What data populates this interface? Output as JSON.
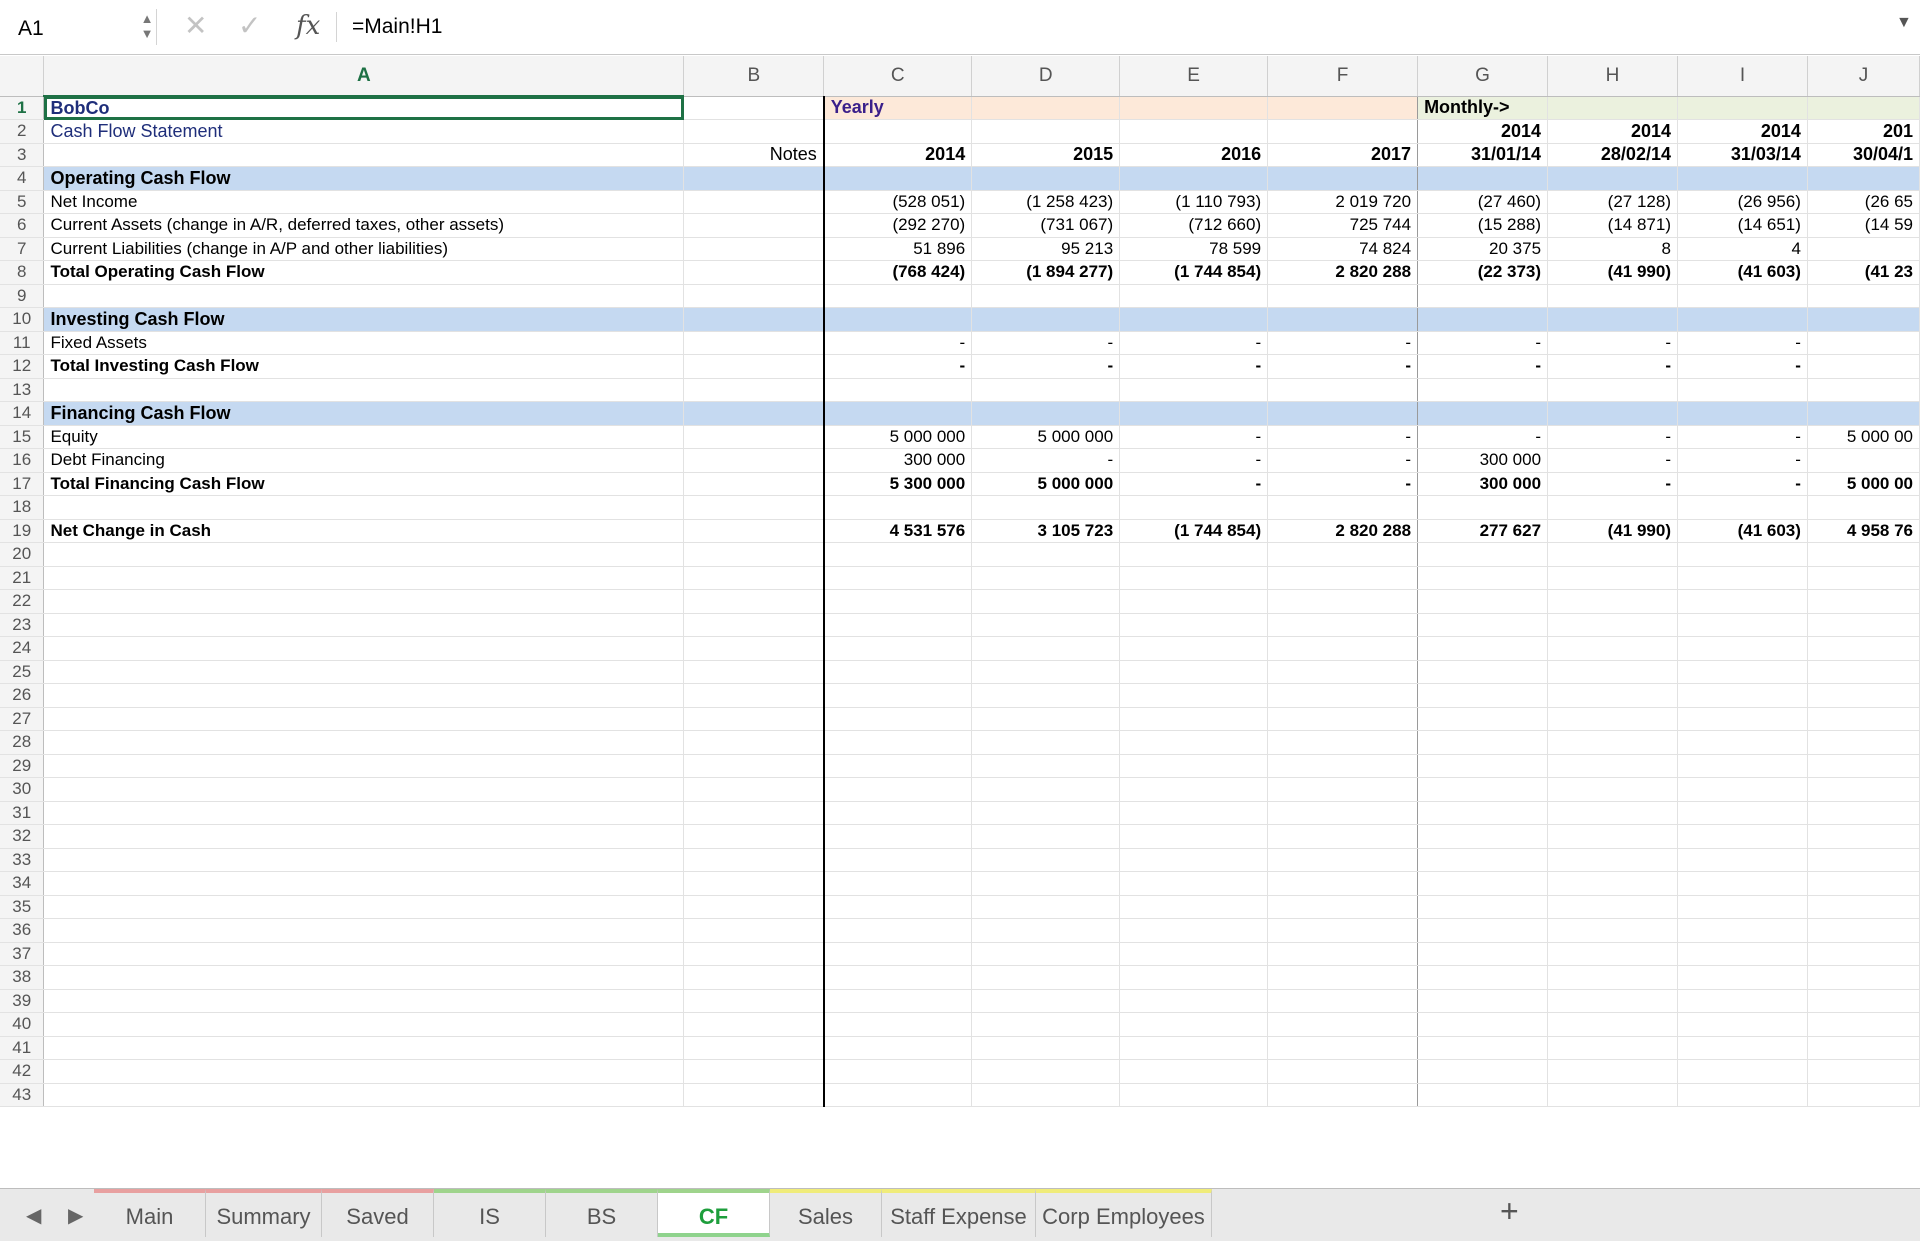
{
  "formula_bar": {
    "name_box": "A1",
    "formula": "=Main!H1",
    "fx_label": "fx"
  },
  "columns": [
    "A",
    "B",
    "C",
    "D",
    "E",
    "F",
    "G",
    "H",
    "I",
    "J"
  ],
  "rows": [
    {
      "n": "1",
      "kind": "title",
      "cells": [
        "BobCo",
        "",
        "Yearly",
        "",
        "",
        "",
        "Monthly->",
        "",
        "",
        ""
      ]
    },
    {
      "n": "2",
      "kind": "subtitle",
      "cells": [
        "Cash Flow Statement",
        "",
        "",
        "",
        "",
        "",
        "2014",
        "2014",
        "2014",
        "201"
      ]
    },
    {
      "n": "3",
      "kind": "header",
      "cells": [
        "",
        "Notes",
        "2014",
        "2015",
        "2016",
        "2017",
        "31/01/14",
        "28/02/14",
        "31/03/14",
        "30/04/1"
      ]
    },
    {
      "n": "4",
      "kind": "section",
      "cells": [
        "Operating Cash Flow",
        "",
        "",
        "",
        "",
        "",
        "",
        "",
        "",
        ""
      ]
    },
    {
      "n": "5",
      "kind": "item",
      "cells": [
        "Net Income",
        "",
        "(528 051)",
        "(1 258 423)",
        "(1 110 793)",
        "2 019 720",
        "(27 460)",
        "(27 128)",
        "(26 956)",
        "(26 65"
      ]
    },
    {
      "n": "6",
      "kind": "item",
      "cells": [
        "Current Assets (change in A/R, deferred taxes, other assets)",
        "",
        "(292 270)",
        "(731 067)",
        "(712 660)",
        "725 744",
        "(15 288)",
        "(14 871)",
        "(14 651)",
        "(14 59"
      ]
    },
    {
      "n": "7",
      "kind": "item",
      "cells": [
        "Current Liabilities (change in A/P and other liabilities)",
        "",
        "51 896",
        "95 213",
        "78 599",
        "74 824",
        "20 375",
        "8",
        "4",
        ""
      ]
    },
    {
      "n": "8",
      "kind": "total",
      "cells": [
        "Total Operating Cash Flow",
        "",
        "(768 424)",
        "(1 894 277)",
        "(1 744 854)",
        "2 820 288",
        "(22 373)",
        "(41 990)",
        "(41 603)",
        "(41 23"
      ]
    },
    {
      "n": "9",
      "kind": "blank",
      "cells": [
        "",
        "",
        "",
        "",
        "",
        "",
        "",
        "",
        "",
        ""
      ]
    },
    {
      "n": "10",
      "kind": "section",
      "cells": [
        "Investing Cash Flow",
        "",
        "",
        "",
        "",
        "",
        "",
        "",
        "",
        ""
      ]
    },
    {
      "n": "11",
      "kind": "item",
      "cells": [
        "Fixed Assets",
        "",
        "-",
        "-",
        "-",
        "-",
        "-",
        "-",
        "-",
        ""
      ]
    },
    {
      "n": "12",
      "kind": "total",
      "cells": [
        "Total Investing Cash Flow",
        "",
        "-",
        "-",
        "-",
        "-",
        "-",
        "-",
        "-",
        ""
      ]
    },
    {
      "n": "13",
      "kind": "blank",
      "cells": [
        "",
        "",
        "",
        "",
        "",
        "",
        "",
        "",
        "",
        ""
      ]
    },
    {
      "n": "14",
      "kind": "section",
      "cells": [
        "Financing Cash Flow",
        "",
        "",
        "",
        "",
        "",
        "",
        "",
        "",
        ""
      ]
    },
    {
      "n": "15",
      "kind": "item",
      "cells": [
        "Equity",
        "",
        "5 000 000",
        "5 000 000",
        "-",
        "-",
        "-",
        "-",
        "-",
        "5 000 00"
      ]
    },
    {
      "n": "16",
      "kind": "item",
      "cells": [
        "Debt Financing",
        "",
        "300 000",
        "-",
        "-",
        "-",
        "300 000",
        "-",
        "-",
        ""
      ]
    },
    {
      "n": "17",
      "kind": "total",
      "cells": [
        "Total Financing Cash Flow",
        "",
        "5 300 000",
        "5 000 000",
        "-",
        "-",
        "300 000",
        "-",
        "-",
        "5 000 00"
      ]
    },
    {
      "n": "18",
      "kind": "blank",
      "cells": [
        "",
        "",
        "",
        "",
        "",
        "",
        "",
        "",
        "",
        ""
      ]
    },
    {
      "n": "19",
      "kind": "total",
      "cells": [
        "Net Change in Cash",
        "",
        "4 531 576",
        "3 105 723",
        "(1 744 854)",
        "2 820 288",
        "277 627",
        "(41 990)",
        "(41 603)",
        "4 958 76"
      ]
    },
    {
      "n": "20",
      "kind": "blank",
      "cells": [
        "",
        "",
        "",
        "",
        "",
        "",
        "",
        "",
        "",
        ""
      ]
    },
    {
      "n": "21",
      "kind": "blank",
      "cells": [
        "",
        "",
        "",
        "",
        "",
        "",
        "",
        "",
        "",
        ""
      ]
    },
    {
      "n": "22",
      "kind": "blank",
      "cells": [
        "",
        "",
        "",
        "",
        "",
        "",
        "",
        "",
        "",
        ""
      ]
    },
    {
      "n": "23",
      "kind": "blank",
      "cells": [
        "",
        "",
        "",
        "",
        "",
        "",
        "",
        "",
        "",
        ""
      ]
    },
    {
      "n": "24",
      "kind": "blank",
      "cells": [
        "",
        "",
        "",
        "",
        "",
        "",
        "",
        "",
        "",
        ""
      ]
    },
    {
      "n": "25",
      "kind": "blank",
      "cells": [
        "",
        "",
        "",
        "",
        "",
        "",
        "",
        "",
        "",
        ""
      ]
    },
    {
      "n": "26",
      "kind": "blank",
      "cells": [
        "",
        "",
        "",
        "",
        "",
        "",
        "",
        "",
        "",
        ""
      ]
    },
    {
      "n": "27",
      "kind": "blank",
      "cells": [
        "",
        "",
        "",
        "",
        "",
        "",
        "",
        "",
        "",
        ""
      ]
    },
    {
      "n": "28",
      "kind": "blank",
      "cells": [
        "",
        "",
        "",
        "",
        "",
        "",
        "",
        "",
        "",
        ""
      ]
    },
    {
      "n": "29",
      "kind": "blank",
      "cells": [
        "",
        "",
        "",
        "",
        "",
        "",
        "",
        "",
        "",
        ""
      ]
    },
    {
      "n": "30",
      "kind": "blank",
      "cells": [
        "",
        "",
        "",
        "",
        "",
        "",
        "",
        "",
        "",
        ""
      ]
    },
    {
      "n": "31",
      "kind": "blank",
      "cells": [
        "",
        "",
        "",
        "",
        "",
        "",
        "",
        "",
        "",
        ""
      ]
    },
    {
      "n": "32",
      "kind": "blank",
      "cells": [
        "",
        "",
        "",
        "",
        "",
        "",
        "",
        "",
        "",
        ""
      ]
    },
    {
      "n": "33",
      "kind": "blank",
      "cells": [
        "",
        "",
        "",
        "",
        "",
        "",
        "",
        "",
        "",
        ""
      ]
    },
    {
      "n": "34",
      "kind": "blank",
      "cells": [
        "",
        "",
        "",
        "",
        "",
        "",
        "",
        "",
        "",
        ""
      ]
    },
    {
      "n": "35",
      "kind": "blank",
      "cells": [
        "",
        "",
        "",
        "",
        "",
        "",
        "",
        "",
        "",
        ""
      ]
    },
    {
      "n": "36",
      "kind": "blank",
      "cells": [
        "",
        "",
        "",
        "",
        "",
        "",
        "",
        "",
        "",
        ""
      ]
    },
    {
      "n": "37",
      "kind": "blank",
      "cells": [
        "",
        "",
        "",
        "",
        "",
        "",
        "",
        "",
        "",
        ""
      ]
    },
    {
      "n": "38",
      "kind": "blank",
      "cells": [
        "",
        "",
        "",
        "",
        "",
        "",
        "",
        "",
        "",
        ""
      ]
    },
    {
      "n": "39",
      "kind": "blank",
      "cells": [
        "",
        "",
        "",
        "",
        "",
        "",
        "",
        "",
        "",
        ""
      ]
    },
    {
      "n": "40",
      "kind": "blank",
      "cells": [
        "",
        "",
        "",
        "",
        "",
        "",
        "",
        "",
        "",
        ""
      ]
    },
    {
      "n": "41",
      "kind": "blank",
      "cells": [
        "",
        "",
        "",
        "",
        "",
        "",
        "",
        "",
        "",
        ""
      ]
    },
    {
      "n": "42",
      "kind": "blank",
      "cells": [
        "",
        "",
        "",
        "",
        "",
        "",
        "",
        "",
        "",
        ""
      ]
    },
    {
      "n": "43",
      "kind": "blank",
      "cells": [
        "",
        "",
        "",
        "",
        "",
        "",
        "",
        "",
        "",
        ""
      ]
    }
  ],
  "sheet_tabs": [
    {
      "label": "Main",
      "color": "#e8a0a0"
    },
    {
      "label": "Summary",
      "color": "#e8a0a0"
    },
    {
      "label": "Saved",
      "color": "#e8a0a0"
    },
    {
      "label": "IS",
      "color": "#9fd48c"
    },
    {
      "label": "BS",
      "color": "#9fd48c"
    },
    {
      "label": "CF",
      "color": "#9fd48c",
      "active": true
    },
    {
      "label": "Sales",
      "color": "#f0ec7a"
    },
    {
      "label": "Staff Expense",
      "color": "#f0ec7a"
    },
    {
      "label": "Corp Employees",
      "color": "#f0ec7a"
    }
  ],
  "add_sheet_label": "+",
  "colors": {
    "selection": "#1e7145",
    "section_fill": "#c5d9f1",
    "yearly_fill": "#fde9d9",
    "monthly_fill": "#ebf1de",
    "title_text": "#1f2e7a"
  },
  "icons": {
    "cancel": "close-icon",
    "enter": "check-icon",
    "prev_sheet": "chevron-left-icon",
    "next_sheet": "chevron-right-icon"
  }
}
